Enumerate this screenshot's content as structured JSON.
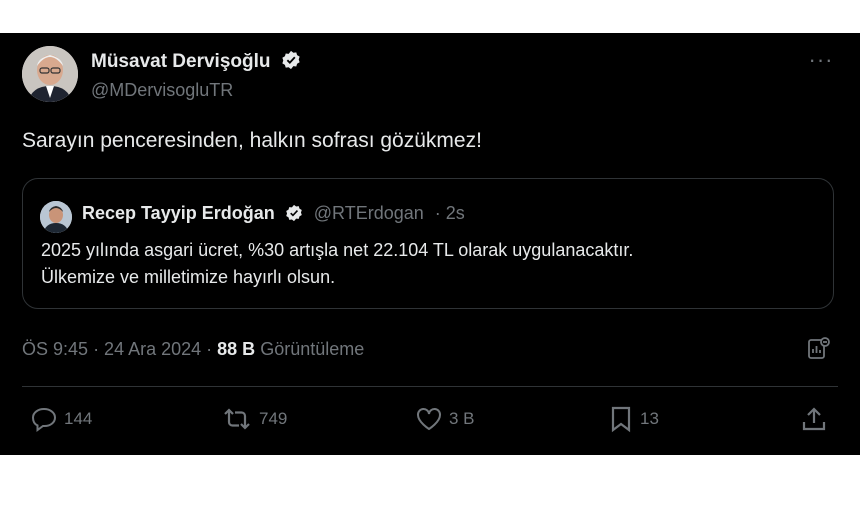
{
  "author": {
    "name": "Müsavat Dervişoğlu",
    "handle": "@MDervisogluTR"
  },
  "tweet": {
    "text": "Sarayın penceresinden, halkın sofrası gözükmez!"
  },
  "quote": {
    "name": "Recep Tayyip Erdoğan",
    "handle": "@RTErdogan",
    "time": "· 2s",
    "line1": "2025 yılında asgari ücret, %30 artışla net 22.104 TL olarak uygulanacaktır.",
    "line2": "Ülkemize ve milletimize hayırlı olsun."
  },
  "meta": {
    "time": "ÖS 9:45",
    "date": "· 24 Ara 2024 ·",
    "views_count": "88 B",
    "views_label": "Görüntüleme"
  },
  "actions": {
    "replies": "144",
    "reposts": "749",
    "likes": "3 B",
    "bookmarks": "13"
  },
  "colors": {
    "background": "#000000",
    "text": "#e7e9ea",
    "muted": "#71767b",
    "border": "#2f3336",
    "verified": "#1d9bf0"
  }
}
